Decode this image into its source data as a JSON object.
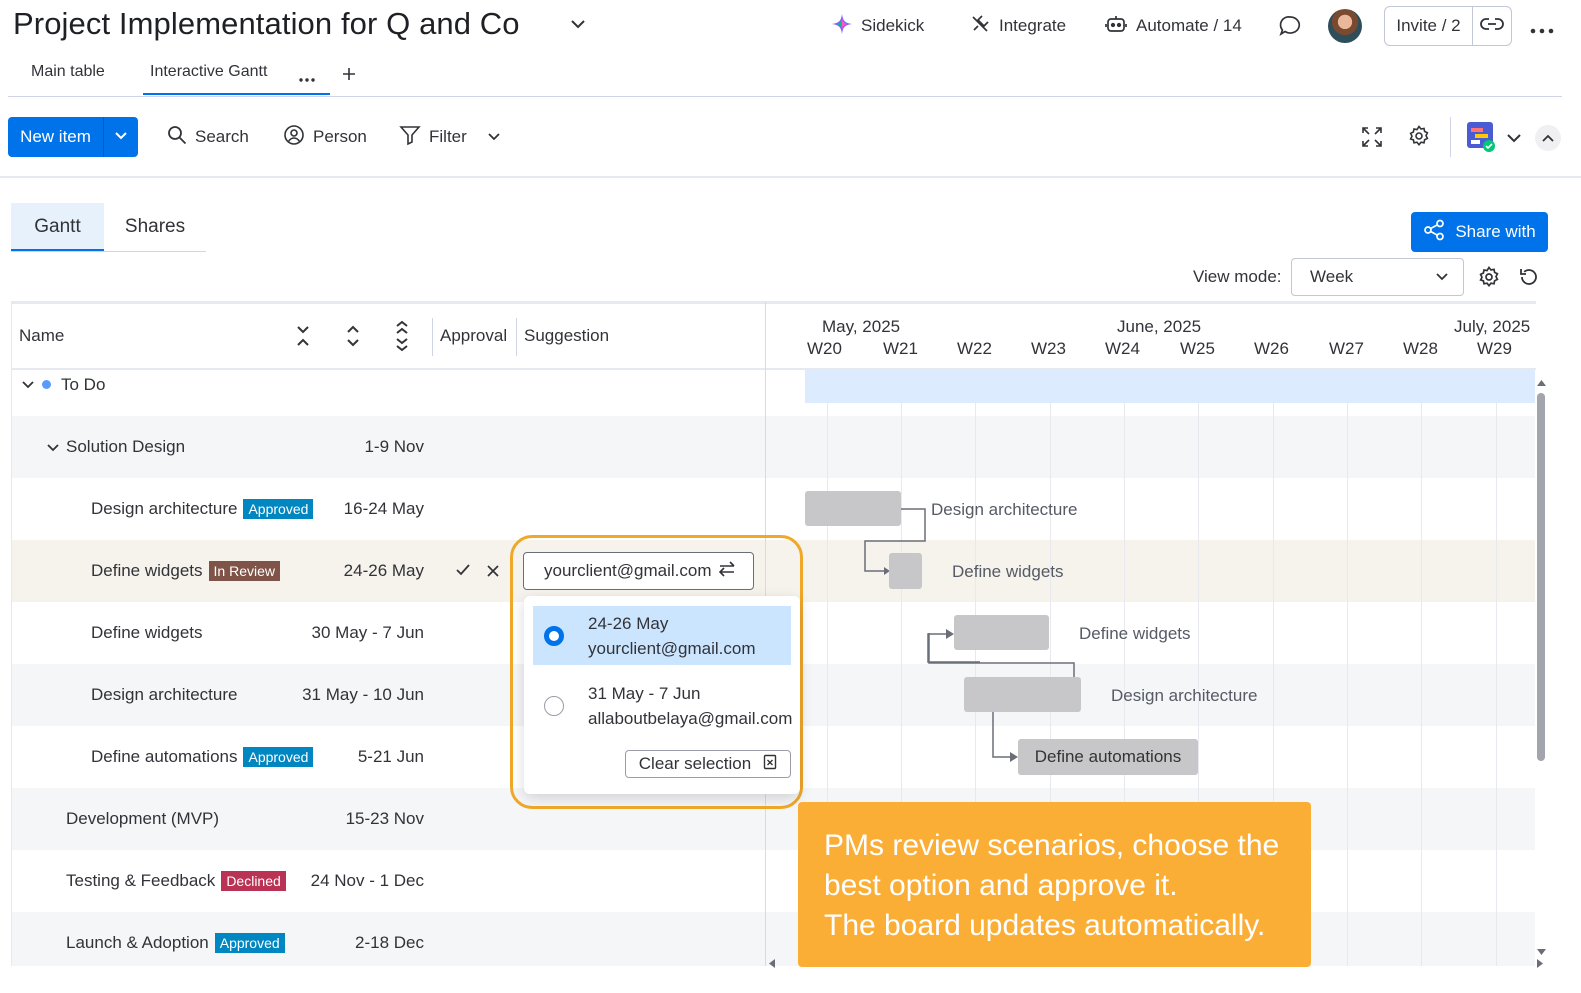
{
  "header": {
    "title": "Project Implementation for Q and Co",
    "sidekick": "Sidekick",
    "integrate": "Integrate",
    "automate": "Automate / 14",
    "invite": "Invite / 2"
  },
  "board_tabs": [
    "Main table",
    "Interactive Gantt"
  ],
  "toolbar": {
    "new_item": "New item",
    "search": "Search",
    "person": "Person",
    "filter": "Filter"
  },
  "view_tabs": [
    "Gantt",
    "Shares"
  ],
  "share_with": "Share with",
  "view_mode": {
    "label": "View mode:",
    "value": "Week"
  },
  "columns": {
    "name": "Name",
    "approval": "Approval",
    "suggestion": "Suggestion"
  },
  "timeline": {
    "months": [
      {
        "label": "May, 2025"
      },
      {
        "label": "June, 2025"
      },
      {
        "label": "July, 2025"
      }
    ],
    "weeks": [
      "W20",
      "W21",
      "W22",
      "W23",
      "W24",
      "W25",
      "W26",
      "W27",
      "W28",
      "W29"
    ]
  },
  "group": {
    "name": "To Do"
  },
  "rows": [
    {
      "name": "Solution Design",
      "dates": "1-9 Nov"
    },
    {
      "name": "Design architecture",
      "badge": "Approved",
      "dates": "16-24 May"
    },
    {
      "name": "Define widgets",
      "badge": "In Review",
      "dates": "24-26 May"
    },
    {
      "name": "Define widgets",
      "dates": "30 May - 7 Jun"
    },
    {
      "name": "Design architecture",
      "dates": "31 May - 10 Jun"
    },
    {
      "name": "Define automations",
      "badge": "Approved",
      "dates": "5-21 Jun"
    },
    {
      "name": "Development (MVP)",
      "dates": "15-23 Nov"
    },
    {
      "name": "Testing & Feedback",
      "badge": "Declined",
      "dates": "24 Nov - 1 Dec"
    },
    {
      "name": "Launch & Adoption",
      "badge": "Approved",
      "dates": "2-18 Dec"
    }
  ],
  "gantt_labels": [
    "Design architecture",
    "Define widgets",
    "Define widgets",
    "Design architecture",
    "Define automations"
  ],
  "suggestion": {
    "value": "yourclient@gmail.com",
    "options": [
      {
        "dates": "24-26 May",
        "email": "yourclient@gmail.com",
        "selected": true
      },
      {
        "dates": "31 May - 7 Jun",
        "email": "allaboutbelaya@gmail.com",
        "selected": false
      }
    ],
    "clear": "Clear selection"
  },
  "callout": {
    "line1": "PMs review scenarios, choose the",
    "line2": "best option and approve it.",
    "line3": "The board updates automatically."
  },
  "colors": {
    "primary": "#0073ea",
    "approved": "#0086c0",
    "in_review": "#7f5347",
    "declined": "#bb3354",
    "callout": "#fbae36",
    "highlight": "#f0a829"
  }
}
